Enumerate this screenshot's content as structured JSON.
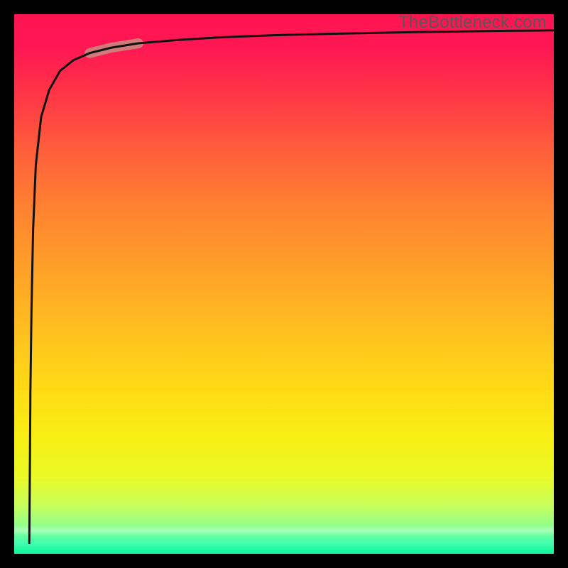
{
  "watermark": "TheBottleneck.com",
  "colors": {
    "gradient_top": "#ff1450",
    "gradient_mid": "#ffc01f",
    "gradient_bottom": "#0cf59d",
    "curve": "#111111",
    "highlight": "#c88f83",
    "frame": "#000000"
  },
  "chart_data": {
    "type": "line",
    "title": "",
    "xlabel": "",
    "ylabel": "",
    "xlim": [
      0,
      100
    ],
    "ylim": [
      0,
      100
    ],
    "x": [
      2.8,
      2.9,
      3.0,
      3.2,
      3.5,
      4.0,
      5.0,
      6.5,
      8.5,
      11.0,
      14.0,
      18.0,
      23.0,
      30.0,
      38.0,
      48.0,
      60.0,
      75.0,
      90.0,
      100.0
    ],
    "values": [
      2.0,
      15.0,
      30.0,
      45.0,
      60.0,
      72.0,
      81.0,
      86.0,
      89.5,
      91.5,
      92.8,
      93.8,
      94.6,
      95.2,
      95.7,
      96.1,
      96.4,
      96.7,
      96.9,
      97.0
    ],
    "highlight_segment": {
      "x_start": 14.0,
      "x_end": 23.0
    },
    "note": "Values read as percent of plot height from bottom (0) to top (100); x as percent of plot width from left (0) to right (100). Curve is an asymptotic saturation shape with a sharp dip near x≈2.8."
  }
}
